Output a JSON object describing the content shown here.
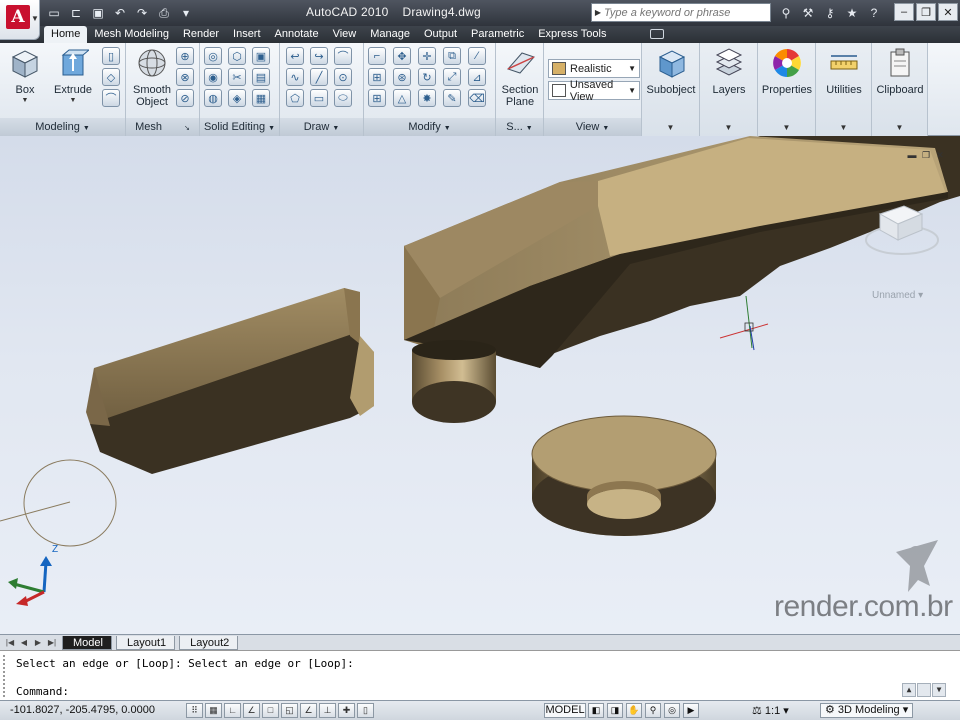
{
  "title_bar": {
    "app_name": "AutoCAD 2010",
    "file_name": "Drawing4.dwg",
    "search_placeholder": "Type a keyword or phrase",
    "quick_access_icons": [
      "new-icon",
      "open-icon",
      "save-icon",
      "undo-icon",
      "redo-icon",
      "plot-icon",
      "dropdown-icon"
    ],
    "help_icons": [
      "binoculars-icon",
      "wrench-icon",
      "key-icon",
      "star-icon",
      "help-icon"
    ],
    "window_controls": [
      "minimize",
      "restore",
      "close"
    ]
  },
  "ribbon_tabs": [
    "Home",
    "Mesh Modeling",
    "Render",
    "Insert",
    "Annotate",
    "View",
    "Manage",
    "Output",
    "Parametric",
    "Express Tools"
  ],
  "active_tab": "Home",
  "ribbon": {
    "modeling": {
      "title": "Modeling",
      "box": "Box",
      "extrude": "Extrude"
    },
    "mesh": {
      "title": "Mesh",
      "smooth_object_line1": "Smooth",
      "smooth_object_line2": "Object"
    },
    "solid_editing": {
      "title": "Solid Editing"
    },
    "draw": {
      "title": "Draw"
    },
    "modify": {
      "title": "Modify"
    },
    "section": {
      "title": "S...",
      "section_plane_line1": "Section",
      "section_plane_line2": "Plane"
    },
    "view": {
      "title": "View",
      "visual_style": "Realistic",
      "named_view": "Unsaved View"
    },
    "subobject": "Subobject",
    "layers": "Layers",
    "properties": "Properties",
    "utilities": "Utilities",
    "clipboard": "Clipboard"
  },
  "viewport": {
    "viewcube_label": "Unnamed",
    "watermark": "render.com.br",
    "ucs_axis_label": "Z"
  },
  "layout_tabs": [
    "Model",
    "Layout1",
    "Layout2"
  ],
  "command_line": {
    "history": "Select an edge or [Loop]: Select an edge or [Loop]:",
    "prompt": "Command:"
  },
  "status_bar": {
    "coordinates": "-101.8027, -205.4795, 0.0000",
    "model": "MODEL",
    "scale": "1:1",
    "workspace": "3D Modeling"
  },
  "colors": {
    "title_bar": "#2f343c",
    "ribbon_bg": "#e6ecf2",
    "solid_face_light": "#a8936a",
    "solid_face_dark": "#3b3325",
    "viewport_bg": "#dde4ee",
    "autocad_red": "#c8102e"
  }
}
